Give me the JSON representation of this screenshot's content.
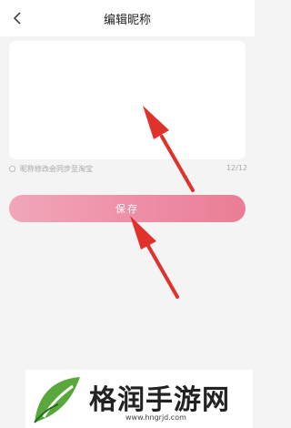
{
  "header": {
    "title": "编辑昵称"
  },
  "nickname": {
    "value": ""
  },
  "sync": {
    "label": "昵称修改会同步至淘宝",
    "counter": "12/12"
  },
  "save": {
    "label": "保存"
  },
  "annotations": {
    "arrow_color": "#e0322b"
  },
  "watermark": {
    "text": "格润手游网",
    "url": "www.hngrjd.com",
    "logo_colors": [
      "#5aa83c",
      "#1f6b22"
    ]
  }
}
